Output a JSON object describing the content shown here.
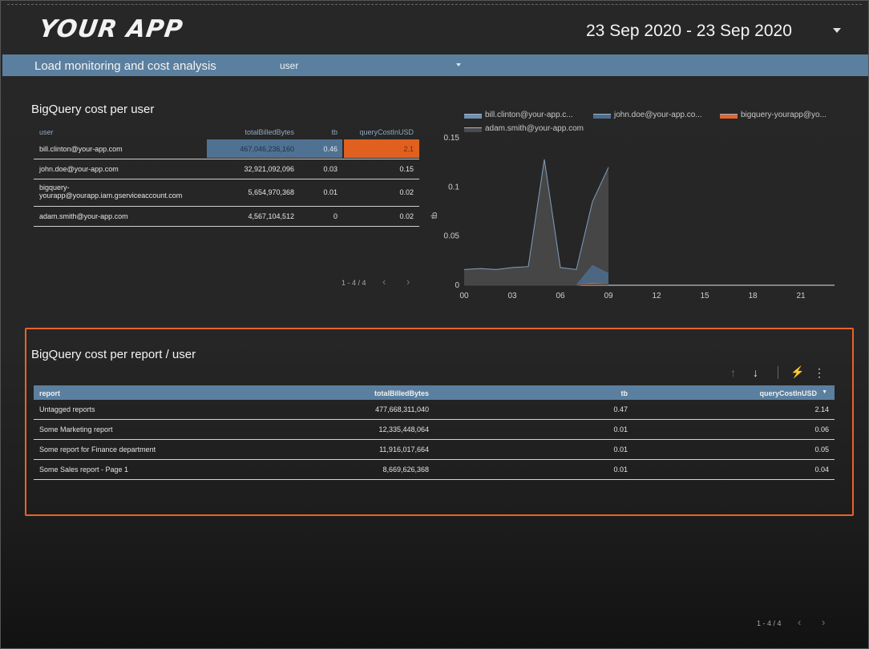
{
  "app": {
    "logo": "YOUR APP",
    "date_range": "23 Sep 2020 - 23 Sep 2020"
  },
  "subbar": {
    "title": "Load monitoring and cost analysis",
    "filter_value": "user"
  },
  "card1": {
    "title": "BigQuery cost per user",
    "columns": [
      "user",
      "totalBilledBytes",
      "tb",
      "queryCostInUSD"
    ],
    "rows": [
      {
        "user": "bill.clinton@your-app.com",
        "totalBilledBytes": "467,046,236,160",
        "tb": "0.46",
        "queryCostInUSD": "2.1",
        "bytes_fraction": 1.0,
        "cost_fraction": 1.0
      },
      {
        "user": "john.doe@your-app.com",
        "totalBilledBytes": "32,921,092,096",
        "tb": "0.03",
        "queryCostInUSD": "0.15",
        "bytes_fraction": 0.07,
        "cost_fraction": 0.07
      },
      {
        "user": "bigquery-\nyourapp@yourapp.iam.gserviceaccount.com",
        "totalBilledBytes": "5,654,970,368",
        "tb": "0.01",
        "queryCostInUSD": "0.02",
        "bytes_fraction": 0.01,
        "cost_fraction": 0.01
      },
      {
        "user": "adam.smith@your-app.com",
        "totalBilledBytes": "4,567,104,512",
        "tb": "0",
        "queryCostInUSD": "0.02",
        "bytes_fraction": 0.01,
        "cost_fraction": 0.01
      }
    ],
    "pager": "1 - 4 / 4"
  },
  "chart_data": {
    "type": "area",
    "ylabel": "tb",
    "ylim": [
      0,
      0.15
    ],
    "yticks": [
      "0",
      "0.05",
      "0.1",
      "0.15"
    ],
    "xticks": [
      "00",
      "03",
      "06",
      "09",
      "12",
      "15",
      "18",
      "21"
    ],
    "x": [
      0,
      1,
      2,
      3,
      4,
      5,
      6,
      7,
      8,
      9
    ],
    "series": [
      {
        "name": "bill.clinton@your-app.c...",
        "color": "#6f8fae",
        "values": [
          0.016,
          0.017,
          0.016,
          0.018,
          0.019,
          0.128,
          0.018,
          0.016,
          0.085,
          0.12
        ]
      },
      {
        "name": "john.doe@your-app.co...",
        "color": "#4d6d8c",
        "values": [
          0,
          0,
          0,
          0,
          0,
          0,
          0,
          0,
          0.02,
          0.012
        ]
      },
      {
        "name": "bigquery-yourapp@yo...",
        "color": "#e8632a",
        "values": [
          0,
          0,
          0,
          0,
          0,
          0,
          0,
          0,
          0.002,
          0.001
        ]
      },
      {
        "name": "adam.smith@your-app.com",
        "color": "#4a4a4a",
        "values": [
          0,
          0,
          0,
          0,
          0,
          0,
          0,
          0,
          0.001,
          0.001
        ]
      }
    ]
  },
  "card2": {
    "title": "BigQuery cost per report / user",
    "columns": [
      "report",
      "totalBilledBytes",
      "tb",
      "queryCostInUSD"
    ],
    "rows": [
      {
        "report": "Untagged reports",
        "totalBilledBytes": "477,668,311,040",
        "tb": "0.47",
        "queryCostInUSD": "2.14"
      },
      {
        "report": "Some Marketing report",
        "totalBilledBytes": "12,335,448,064",
        "tb": "0.01",
        "queryCostInUSD": "0.06"
      },
      {
        "report": "Some report for Finance department",
        "totalBilledBytes": "11,916,017,664",
        "tb": "0.01",
        "queryCostInUSD": "0.05"
      },
      {
        "report": "Some Sales report - Page 1",
        "totalBilledBytes": "8,669,626,368",
        "tb": "0.01",
        "queryCostInUSD": "0.04"
      }
    ],
    "pager": "1 - 4 / 4"
  },
  "icons": {
    "sort_up": "arrow-up-icon",
    "sort_down": "arrow-down-icon",
    "explore": "lightning-icon",
    "more": "more-vertical-icon"
  },
  "colors": {
    "accent_blue": "#5b7f9f",
    "accent_orange": "#e8632a",
    "background": "#262626"
  }
}
